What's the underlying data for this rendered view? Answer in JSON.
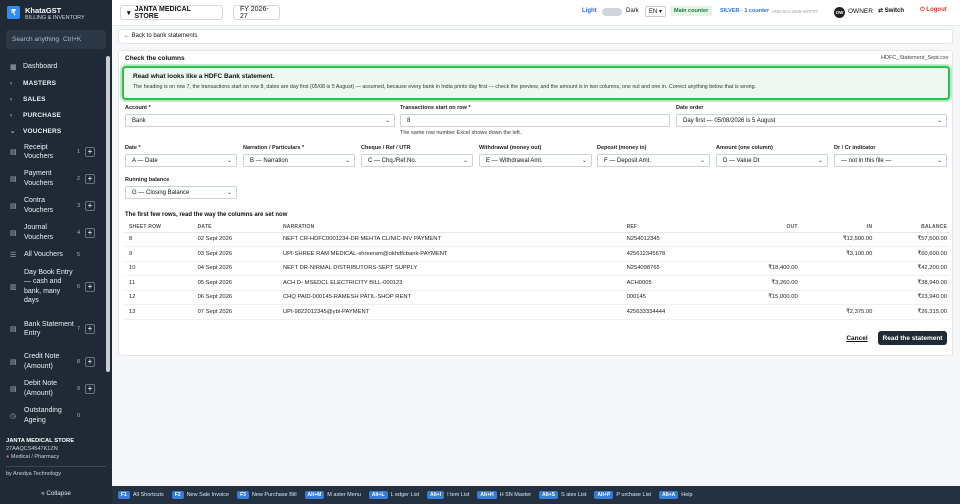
{
  "app": {
    "name": "KhataGST",
    "tagline": "BILLING & INVENTORY",
    "logo": "₹"
  },
  "sidebar": {
    "search_placeholder": "Search anything",
    "search_shortcut": "Ctrl+K",
    "dashboard": "Dashboard",
    "sections": [
      "MASTERS",
      "SALES",
      "PURCHASE"
    ],
    "vouchers_title": "VOUCHERS",
    "items": [
      {
        "label": "Receipt Vouchers",
        "count": "1"
      },
      {
        "label": "Payment Vouchers",
        "count": "2"
      },
      {
        "label": "Contra Vouchers",
        "count": "3"
      },
      {
        "label": "Journal Vouchers",
        "count": "4"
      },
      {
        "label": "All Vouchers",
        "count": "5"
      },
      {
        "label": "Day Book Entry — cash and bank, many days",
        "count": "6"
      },
      {
        "label": "Bank Statement Entry",
        "count": "7"
      },
      {
        "label": "Credit Note (Amount)",
        "count": "8"
      },
      {
        "label": "Debit Note (Amount)",
        "count": "9"
      },
      {
        "label": "Outstanding Ageing",
        "count": "0"
      }
    ],
    "company": "JANTA MEDICAL STORE",
    "gstin": "27AAQCS4547K1ZN",
    "business": "Medical / Pharmacy",
    "by": "by Anedya Technology",
    "collapse": "« Collapse"
  },
  "topbar": {
    "company": "JANTA MEDICAL STORE",
    "fy": "FY 2026-27",
    "light": "Light",
    "dark": "Dark",
    "lang": "EN",
    "counter": "Main counter",
    "plan": "SILVER · 1 counter",
    "plan_code": "AND-SLV-2026-A0TF07",
    "owner_initials": "OW",
    "owner": "OWNER",
    "switch": "Switch",
    "logout": "Logout"
  },
  "page": {
    "back": "← Back to bank statements",
    "check_title": "Check the columns",
    "file": "HDFC_Statement_Sept.csv",
    "banner_title": "Read what looks like a HDFC Bank statement.",
    "banner_text": "The heading is on row 7, the transactions start on row 8, dates are day first (05/08 is 5 August) — assumed, because every bank in India prints day first — check the preview, and the amount is in two columns, one out and one in. Correct anything below that is wrong.",
    "fields": {
      "account_label": "Account *",
      "account": "Bank",
      "txstart_label": "Transactions start on row *",
      "txstart": "8",
      "txstart_hint": "The same row number Excel shows down the left.",
      "dateorder_label": "Date order",
      "dateorder": "Day first — 05/08/2026 is 5 August",
      "date_label": "Date *",
      "date": "A — Date",
      "narr_label": "Narration / Particulars *",
      "narr": "B — Narration",
      "cheque_label": "Cheque / Ref / UTR",
      "cheque": "C — Chq./Ref.No.",
      "withdraw_label": "Withdrawal (money out)",
      "withdraw": "E — Withdrawal Amt.",
      "deposit_label": "Deposit (money in)",
      "deposit": "F — Deposit Amt.",
      "amount_label": "Amount (one column)",
      "amount": "D — Value Dt",
      "drcr_label": "Dr / Cr indicator",
      "drcr": "— not in this file —",
      "balance_label": "Running balance",
      "balance": "G — Closing Balance"
    },
    "preview_title": "The first few rows, read the way the columns are set now",
    "table": {
      "headers": [
        "SHEET ROW",
        "DATE",
        "NARRATION",
        "REF",
        "OUT",
        "IN",
        "BALANCE"
      ],
      "rows": [
        [
          "8",
          "02 Sept 2026",
          "NEFT CR-HDFC0001234-DR MEHTA CLINIC-INV PAYMENT",
          "N254012345",
          "",
          "₹12,500.00",
          "₹57,500.00"
        ],
        [
          "9",
          "03 Sept 2026",
          "UPI-SHREE RAM MEDICAL-shreeram@okhdfcbank-PAYMENT",
          "425612345678",
          "",
          "₹3,100.00",
          "₹60,600.00"
        ],
        [
          "10",
          "04 Sept 2026",
          "NEFT DR-NIRMAL DISTRIBUTORS-SEPT SUPPLY",
          "N254098765",
          "₹18,400.00",
          "",
          "₹42,200.00"
        ],
        [
          "11",
          "05 Sept 2026",
          "ACH D- MSEDCL ELECTRICITY BILL-000123",
          "ACH0005",
          "₹3,260.00",
          "",
          "₹38,940.00"
        ],
        [
          "12",
          "06 Sept 2026",
          "CHQ PAID-000145-RAMESH PATIL-SHOP RENT",
          "000145",
          "₹15,000.00",
          "",
          "₹23,940.00"
        ],
        [
          "13",
          "07 Sept 2026",
          "UPI-9822012345@ybl-PAYMENT",
          "425633334444",
          "",
          "₹2,375.00",
          "₹26,315.00"
        ]
      ]
    },
    "cancel": "Cancel",
    "read": "Read the statement"
  },
  "shortcuts": [
    {
      "key": "F1",
      "label": "All Shortcuts"
    },
    {
      "key": "F2",
      "label": "New Sale Invoice"
    },
    {
      "key": "F3",
      "label": "New Purchase Bill"
    },
    {
      "key": "Alt+M",
      "label": "M aster Menu"
    },
    {
      "key": "Alt+L",
      "label": "L edger List"
    },
    {
      "key": "Alt+I",
      "label": "I tem List"
    },
    {
      "key": "Alt+H",
      "label": "H SN Master"
    },
    {
      "key": "Alt+S",
      "label": "S ales List"
    },
    {
      "key": "Alt+P",
      "label": "P urchase List"
    },
    {
      "key": "Alt+A",
      "label": "Help"
    }
  ]
}
